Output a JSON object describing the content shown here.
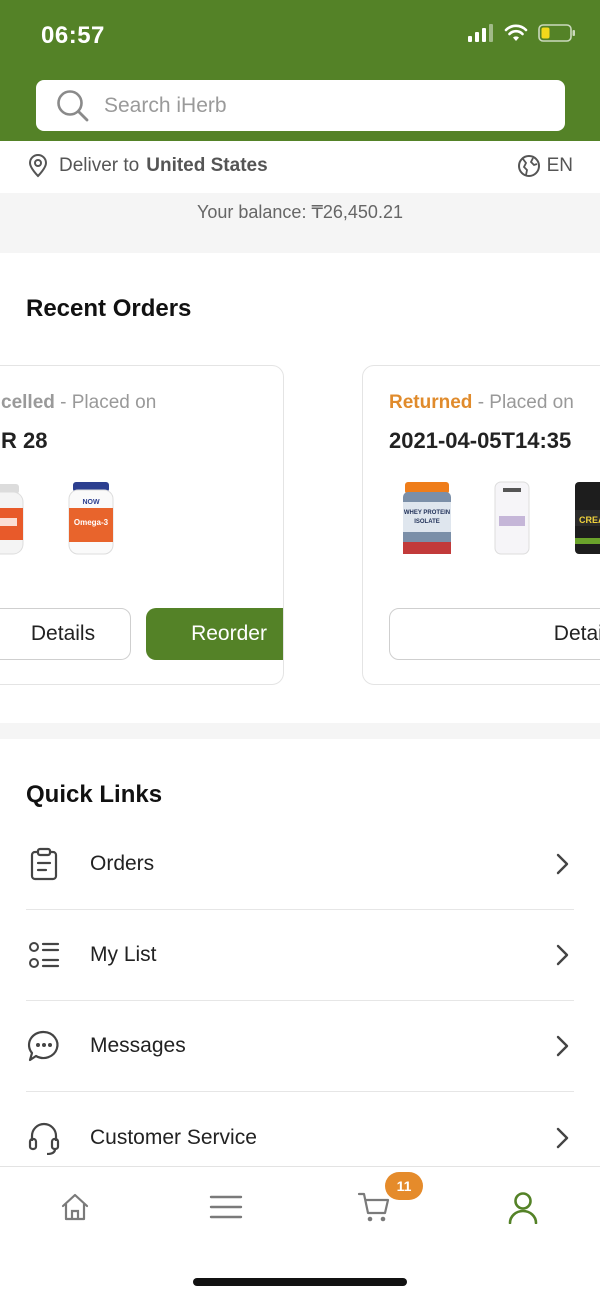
{
  "status_bar": {
    "time": "06:57"
  },
  "search": {
    "placeholder": "Search iHerb"
  },
  "deliver": {
    "prefix": "Deliver to",
    "country": "United States",
    "language": "EN"
  },
  "balance": {
    "text": "Your balance: ₸26,450.21"
  },
  "recent_orders": {
    "title": "Recent Orders",
    "cards": [
      {
        "status": "Cancelled",
        "status_visible": "celled",
        "placed_label": "- Placed on",
        "date_visible": "R 28",
        "status_color": "#9a9a9a",
        "details_label": "Details",
        "reorder_label": "Reorder",
        "products": [
          "omega-3-bottle",
          "omega-3-bottle"
        ]
      },
      {
        "status": "Returned",
        "placed_label": "- Placed on",
        "date": "2021-04-05T14:35",
        "status_color": "#e08b2c",
        "details_label": "Details",
        "products": [
          "whey-protein-isolate-tub",
          "deodorant-stick",
          "creatine-tub"
        ]
      }
    ]
  },
  "quick_links": {
    "title": "Quick Links",
    "items": [
      {
        "label": "Orders",
        "icon": "clipboard-icon"
      },
      {
        "label": "My List",
        "icon": "list-icon"
      },
      {
        "label": "Messages",
        "icon": "chat-bubble-icon"
      },
      {
        "label": "Customer Service",
        "icon": "headset-icon"
      }
    ]
  },
  "bottom_nav": {
    "items": [
      "home-icon",
      "menu-icon",
      "cart-icon",
      "account-icon"
    ],
    "cart_count": "11",
    "active": "account-icon"
  },
  "colors": {
    "brand_green": "#548227",
    "accent_orange": "#e58b2b"
  }
}
